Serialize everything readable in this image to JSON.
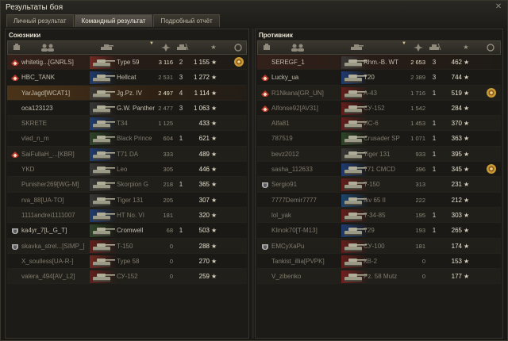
{
  "window": {
    "title": "Результаты боя"
  },
  "tabs": [
    {
      "label": "Личный результат",
      "active": false
    },
    {
      "label": "Командный результат",
      "active": true
    },
    {
      "label": "Подробный отчёт",
      "active": false
    }
  ],
  "allies": {
    "title": "Союзники",
    "rows": [
      {
        "name": "whitetig...[GNRLS]",
        "tank": "Type 59",
        "damage": "3 116",
        "kills": "2",
        "xp": "1 155",
        "badge": "diamond",
        "medal": true,
        "style": "hl-red",
        "dead": false,
        "nation": "china"
      },
      {
        "name": "HBC_TANK",
        "tank": "Hellcat",
        "damage": "2 531",
        "kills": "3",
        "xp": "1 272",
        "badge": "diamond",
        "medal": false,
        "style": "",
        "dead": false,
        "nation": "usa"
      },
      {
        "name": "YarJagd[WCAT1]",
        "tank": "Jg.Pz. IV",
        "damage": "2 497",
        "kills": "4",
        "xp": "1 114",
        "badge": "",
        "medal": false,
        "style": "hl-self",
        "dead": false,
        "nation": "germany"
      },
      {
        "name": "oca123123",
        "tank": "G.W. Panther",
        "damage": "2 477",
        "kills": "3",
        "xp": "1 063",
        "badge": "",
        "medal": false,
        "style": "",
        "dead": false,
        "nation": "germany"
      },
      {
        "name": "SKRETE",
        "tank": "T34",
        "damage": "1 125",
        "kills": "",
        "xp": "433",
        "badge": "",
        "medal": false,
        "style": "",
        "dead": true,
        "nation": "usa"
      },
      {
        "name": "vlad_n_m",
        "tank": "Black Prince",
        "damage": "604",
        "kills": "1",
        "xp": "621",
        "badge": "",
        "medal": false,
        "style": "",
        "dead": true,
        "nation": "uk"
      },
      {
        "name": "SaiFullaH_...[KBR]",
        "tank": "T71 DA",
        "damage": "333",
        "kills": "",
        "xp": "489",
        "badge": "diamond",
        "medal": false,
        "style": "",
        "dead": true,
        "nation": "usa"
      },
      {
        "name": "YKD",
        "tank": "Leo",
        "damage": "305",
        "kills": "",
        "xp": "446",
        "badge": "",
        "medal": false,
        "style": "",
        "dead": true,
        "nation": "germany"
      },
      {
        "name": "Punisher269[WG-M]",
        "tank": "Skorpion G",
        "damage": "218",
        "kills": "1",
        "xp": "365",
        "badge": "",
        "medal": false,
        "style": "",
        "dead": true,
        "nation": "germany"
      },
      {
        "name": "rva_88[UA-TO]",
        "tank": "Tiger 131",
        "damage": "205",
        "kills": "",
        "xp": "307",
        "badge": "",
        "medal": false,
        "style": "",
        "dead": true,
        "nation": "germany"
      },
      {
        "name": "1111andrei1111007",
        "tank": "HT No. VI",
        "damage": "181",
        "kills": "",
        "xp": "320",
        "badge": "",
        "medal": false,
        "style": "",
        "dead": true,
        "nation": "usa"
      },
      {
        "name": "ka4yr_7[L_G_T]",
        "tank": "Cromwell",
        "damage": "68",
        "kills": "1",
        "xp": "503",
        "badge": "shield",
        "medal": false,
        "style": "",
        "dead": false,
        "nation": "uk"
      },
      {
        "name": "skavka_strel...[SIMP_]",
        "tank": "T-150",
        "damage": "0",
        "kills": "",
        "xp": "288",
        "badge": "shield",
        "medal": false,
        "style": "",
        "dead": true,
        "nation": "ussr"
      },
      {
        "name": "X_soulless[UA-R-]",
        "tank": "Type 58",
        "damage": "0",
        "kills": "",
        "xp": "270",
        "badge": "",
        "medal": false,
        "style": "",
        "dead": true,
        "nation": "china"
      },
      {
        "name": "valera_494[AV_L2]",
        "tank": "СУ-152",
        "damage": "0",
        "kills": "",
        "xp": "259",
        "badge": "",
        "medal": false,
        "style": "",
        "dead": true,
        "nation": "ussr"
      }
    ]
  },
  "enemies": {
    "title": "Противник",
    "rows": [
      {
        "name": "SEREGF_1",
        "tank": "Rhm.-B. WT",
        "damage": "2 653",
        "kills": "3",
        "xp": "462",
        "badge": "",
        "medal": false,
        "style": "hl-red",
        "dead": false,
        "nation": "germany"
      },
      {
        "name": "Lucky_ua",
        "tank": "T20",
        "damage": "2 389",
        "kills": "3",
        "xp": "744",
        "badge": "diamond",
        "medal": false,
        "style": "",
        "dead": false,
        "nation": "usa"
      },
      {
        "name": "R1Nkana[GR_UN]",
        "tank": "A-43",
        "damage": "1 716",
        "kills": "1",
        "xp": "519",
        "badge": "diamond",
        "medal": true,
        "style": "",
        "dead": true,
        "nation": "ussr"
      },
      {
        "name": "Alfonse92[AV31]",
        "tank": "СУ-152",
        "damage": "1 542",
        "kills": "",
        "xp": "284",
        "badge": "diamond",
        "medal": false,
        "style": "",
        "dead": true,
        "nation": "ussr"
      },
      {
        "name": "Alfa81",
        "tank": "ИС-6",
        "damage": "1 453",
        "kills": "1",
        "xp": "370",
        "badge": "",
        "medal": false,
        "style": "",
        "dead": true,
        "nation": "ussr"
      },
      {
        "name": "787519",
        "tank": "Crusader SP",
        "damage": "1 071",
        "kills": "1",
        "xp": "363",
        "badge": "",
        "medal": false,
        "style": "",
        "dead": true,
        "nation": "uk"
      },
      {
        "name": "bevz2012",
        "tank": "Tiger 131",
        "damage": "933",
        "kills": "1",
        "xp": "395",
        "badge": "",
        "medal": false,
        "style": "",
        "dead": true,
        "nation": "germany"
      },
      {
        "name": "sasha_112633",
        "tank": "T71 CMCD",
        "damage": "396",
        "kills": "1",
        "xp": "345",
        "badge": "",
        "medal": true,
        "style": "",
        "dead": true,
        "nation": "usa"
      },
      {
        "name": "Sergio91",
        "tank": "T-150",
        "damage": "313",
        "kills": "",
        "xp": "231",
        "badge": "shield",
        "medal": false,
        "style": "",
        "dead": true,
        "nation": "ussr"
      },
      {
        "name": "7777Demir7777",
        "tank": "Ikv 65 II",
        "damage": "222",
        "kills": "",
        "xp": "212",
        "badge": "",
        "medal": false,
        "style": "",
        "dead": true,
        "nation": "sweden"
      },
      {
        "name": "lol_yak",
        "tank": "T-34-85",
        "damage": "195",
        "kills": "1",
        "xp": "303",
        "badge": "",
        "medal": false,
        "style": "",
        "dead": true,
        "nation": "ussr"
      },
      {
        "name": "Klinok70[T-M13]",
        "tank": "T29",
        "damage": "193",
        "kills": "1",
        "xp": "265",
        "badge": "",
        "medal": false,
        "style": "",
        "dead": true,
        "nation": "usa"
      },
      {
        "name": "EMCyXaPu",
        "tank": "СУ-100",
        "damage": "181",
        "kills": "",
        "xp": "174",
        "badge": "shield",
        "medal": false,
        "style": "",
        "dead": true,
        "nation": "ussr"
      },
      {
        "name": "Tankist_illia[PVPK]",
        "tank": "КВ-2",
        "damage": "0",
        "kills": "",
        "xp": "153",
        "badge": "",
        "medal": false,
        "style": "",
        "dead": true,
        "nation": "ussr"
      },
      {
        "name": "V_zibenko",
        "tank": "Pz. 58 Mutz",
        "damage": "0",
        "kills": "",
        "xp": "177",
        "badge": "",
        "medal": false,
        "style": "",
        "dead": true,
        "nation": "switzerland"
      }
    ]
  },
  "colors": {
    "highlight_self": "#4a3318",
    "highlight_red": "#33201a",
    "xp_star": "#d7d1c0",
    "medal": "#c99a35"
  },
  "star_glyph": "★"
}
